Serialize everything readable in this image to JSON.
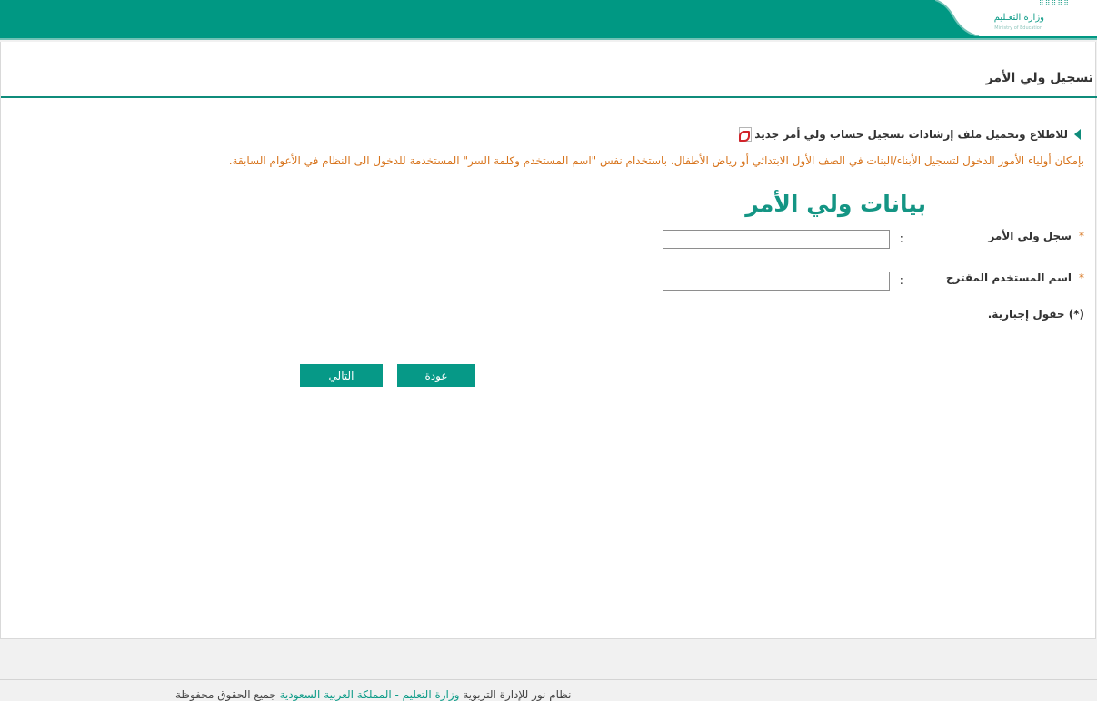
{
  "header": {
    "logo_ar": "وزارة التعـليم",
    "logo_en": "Ministry of Education",
    "logo_dots": "⠿⠿⠿⠿⠿",
    "bar_color": "#009883"
  },
  "page": {
    "title": "تسجيل ولي الأمر"
  },
  "guide": {
    "link_text": "للاطلاع وتحميل ملف إرشادات تسجيل حساب ولي أمر جديد",
    "icon": "pdf-icon"
  },
  "notice": {
    "text": "بإمكان أولياء الأمور الدخول لتسجيل الأبناء/البنات في الصف الأول الابتدائي أو رياض الأطفال، باستخدام نفس \"اسم المستخدم وكلمة السر\" المستخدمة للدخول الى النظام في الأعوام السابقة.",
    "color": "#d7731b"
  },
  "form": {
    "section_title": "بيانات ولي الأمر",
    "fields": [
      {
        "label": "سجل ولي الأمر",
        "required_mark": "*",
        "colon": ":",
        "value": ""
      },
      {
        "label": "اسم المستخدم المقترح",
        "required_mark": "*",
        "colon": ":",
        "value": ""
      }
    ],
    "required_note": "(*) حقول إجبارية."
  },
  "buttons": {
    "back_label": "عودة",
    "next_label": "التالي",
    "color": "#069987"
  },
  "footer": {
    "part1": "نظام نور للإدارة التربوية",
    "link1": "وزارة التعليم",
    "sep": " - ",
    "link2": "المملكة العربية السعودية",
    "part2": "جميع الحقوق محفوظة"
  }
}
